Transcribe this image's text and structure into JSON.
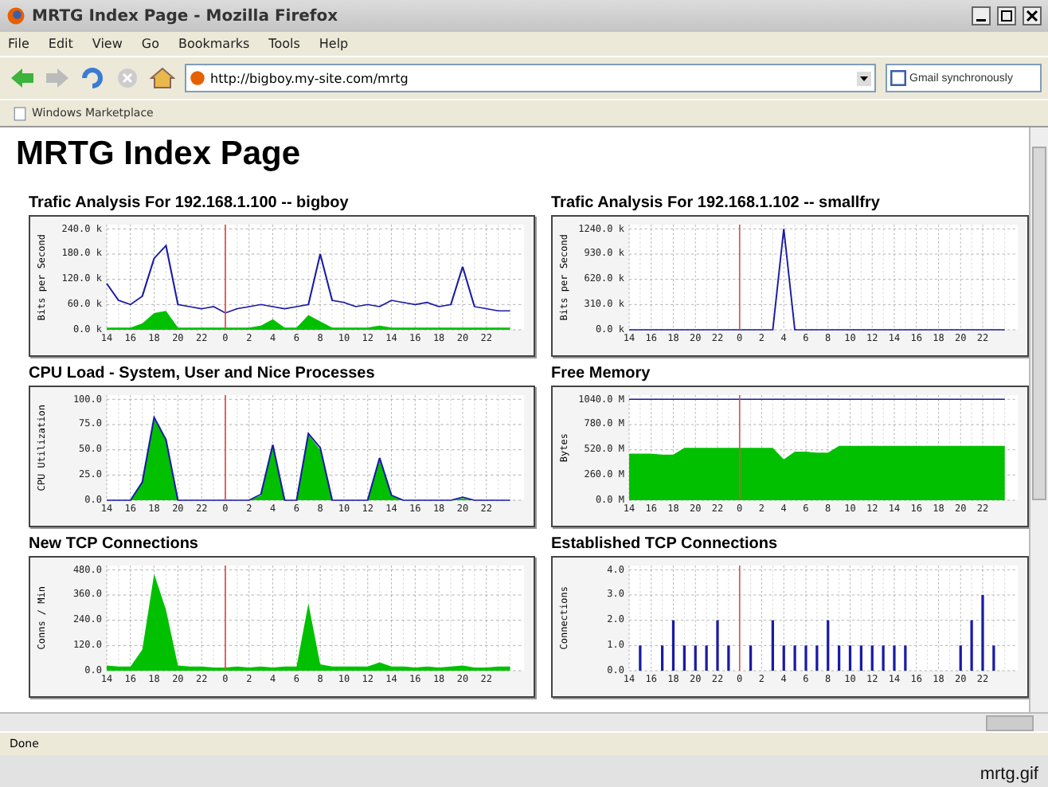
{
  "window": {
    "title": "MRTG Index Page - Mozilla Firefox"
  },
  "menu": [
    "File",
    "Edit",
    "View",
    "Go",
    "Bookmarks",
    "Tools",
    "Help"
  ],
  "address": {
    "value": "http://bigboy.my-site.com/mrtg"
  },
  "search": {
    "placeholder": "Gmail synchronously"
  },
  "bookmarks": [
    "Windows Marketplace"
  ],
  "page": {
    "heading": "MRTG Index Page",
    "graphs": [
      {
        "title": "Trafic Analysis For 192.168.1.100 -- bigboy",
        "chart_data": {
          "type": "area",
          "ylabel": "Bits per Second",
          "grid": true,
          "categories": [
            "14",
            null,
            "16",
            null,
            "18",
            null,
            "20",
            null,
            "22",
            null,
            "0",
            null,
            "2",
            null,
            "4",
            null,
            "6",
            null,
            "8",
            null,
            "10",
            null,
            "12",
            null,
            "14",
            null,
            "16",
            null,
            "18",
            null,
            "20",
            null,
            "22",
            null,
            null
          ],
          "ylim": [
            0,
            240
          ],
          "yticks": [
            {
              "value": 240,
              "label": "240.0 k"
            },
            {
              "value": 180,
              "label": "180.0 k"
            },
            {
              "value": 120,
              "label": "120.0 k"
            },
            {
              "value": 60,
              "label": "60.0 k"
            },
            {
              "value": 0,
              "label": "0.0 k"
            }
          ],
          "series": [
            {
              "color": "#00c000",
              "values": [
                5,
                5,
                5,
                15,
                40,
                45,
                5,
                5,
                5,
                5,
                5,
                5,
                5,
                10,
                25,
                5,
                5,
                35,
                20,
                5,
                5,
                5,
                5,
                10,
                5,
                5,
                5,
                5,
                5,
                5,
                5,
                5,
                5,
                5,
                5
              ]
            },
            {
              "type": "line",
              "color": "#1a1aa6",
              "values": [
                110,
                70,
                60,
                80,
                170,
                200,
                60,
                55,
                50,
                55,
                40,
                50,
                55,
                60,
                55,
                50,
                55,
                60,
                180,
                70,
                65,
                55,
                60,
                55,
                70,
                65,
                60,
                65,
                55,
                60,
                150,
                55,
                50,
                45,
                45
              ]
            }
          ]
        }
      },
      {
        "title": "Trafic Analysis For 192.168.1.102 -- smallfry",
        "chart_data": {
          "type": "line",
          "ylabel": "Bits per Second",
          "grid": true,
          "categories": [
            "14",
            null,
            "16",
            null,
            "18",
            null,
            "20",
            null,
            "22",
            null,
            "0",
            null,
            "2",
            null,
            "4",
            null,
            "6",
            null,
            "8",
            null,
            "10",
            null,
            "12",
            null,
            "14",
            null,
            "16",
            null,
            "18",
            null,
            "20",
            null,
            "22",
            null,
            null
          ],
          "ylim": [
            0,
            1240
          ],
          "yticks": [
            {
              "value": 1240,
              "label": "1240.0 k"
            },
            {
              "value": 930,
              "label": "930.0 k"
            },
            {
              "value": 620,
              "label": "620.0 k"
            },
            {
              "value": 310,
              "label": "310.0 k"
            },
            {
              "value": 0,
              "label": "0.0 k"
            }
          ],
          "series": [
            {
              "color": "#1a1aa6",
              "values": [
                0,
                0,
                0,
                0,
                0,
                0,
                0,
                0,
                0,
                0,
                0,
                0,
                0,
                0,
                1240,
                0,
                0,
                0,
                0,
                0,
                0,
                0,
                0,
                0,
                0,
                0,
                0,
                0,
                0,
                0,
                0,
                0,
                0,
                0,
                0
              ]
            }
          ]
        }
      },
      {
        "title": "CPU Load - System, User and Nice Processes",
        "chart_data": {
          "type": "area",
          "ylabel": "CPU Utilization",
          "grid": true,
          "categories": [
            "14",
            null,
            "16",
            null,
            "18",
            null,
            "20",
            null,
            "22",
            null,
            "0",
            null,
            "2",
            null,
            "4",
            null,
            "6",
            null,
            "8",
            null,
            "10",
            null,
            "12",
            null,
            "14",
            null,
            "16",
            null,
            "18",
            null,
            "20",
            null,
            "22",
            null,
            null
          ],
          "ylim": [
            0,
            100
          ],
          "yticks": [
            {
              "value": 100,
              "label": "100.0"
            },
            {
              "value": 75,
              "label": "75.0"
            },
            {
              "value": 50,
              "label": "50.0"
            },
            {
              "value": 25,
              "label": "25.0"
            },
            {
              "value": 0,
              "label": "0.0"
            }
          ],
          "series": [
            {
              "color": "#00c000",
              "values": [
                0,
                0,
                0,
                18,
                80,
                60,
                0,
                0,
                0,
                0,
                0,
                0,
                0,
                5,
                55,
                0,
                0,
                65,
                50,
                0,
                0,
                0,
                0,
                40,
                5,
                0,
                0,
                0,
                0,
                0,
                2,
                0,
                0,
                0,
                0
              ]
            },
            {
              "type": "line",
              "color": "#1a1aa6",
              "values": [
                0,
                0,
                0,
                18,
                82,
                60,
                0,
                0,
                0,
                0,
                0,
                0,
                0,
                6,
                55,
                0,
                0,
                66,
                52,
                0,
                0,
                0,
                0,
                42,
                5,
                0,
                0,
                0,
                0,
                0,
                3,
                0,
                0,
                0,
                0
              ]
            }
          ]
        }
      },
      {
        "title": "Free Memory",
        "chart_data": {
          "type": "area",
          "ylabel": "Bytes",
          "grid": true,
          "categories": [
            "14",
            null,
            "16",
            null,
            "18",
            null,
            "20",
            null,
            "22",
            null,
            "0",
            null,
            "2",
            null,
            "4",
            null,
            "6",
            null,
            "8",
            null,
            "10",
            null,
            "12",
            null,
            "14",
            null,
            "16",
            null,
            "18",
            null,
            "20",
            null,
            "22",
            null,
            null
          ],
          "ylim": [
            0,
            1040
          ],
          "yticks": [
            {
              "value": 1040,
              "label": "1040.0 M"
            },
            {
              "value": 780,
              "label": "780.0 M"
            },
            {
              "value": 520,
              "label": "520.0 M"
            },
            {
              "value": 260,
              "label": "260.0 M"
            },
            {
              "value": 0,
              "label": "0.0 M"
            }
          ],
          "series": [
            {
              "color": "#00c000",
              "values": [
                480,
                480,
                480,
                470,
                470,
                540,
                540,
                540,
                540,
                540,
                540,
                540,
                540,
                540,
                420,
                500,
                500,
                490,
                490,
                560,
                560,
                560,
                560,
                560,
                560,
                560,
                560,
                560,
                560,
                560,
                560,
                560,
                560,
                560,
                560
              ]
            },
            {
              "type": "line",
              "color": "#1a1aa6",
              "values": [
                1040,
                1040,
                1040,
                1040,
                1040,
                1040,
                1040,
                1040,
                1040,
                1040,
                1040,
                1040,
                1040,
                1040,
                1040,
                1040,
                1040,
                1040,
                1040,
                1040,
                1040,
                1040,
                1040,
                1040,
                1040,
                1040,
                1040,
                1040,
                1040,
                1040,
                1040,
                1040,
                1040,
                1040,
                1040
              ]
            }
          ]
        }
      },
      {
        "title": "New TCP Connections",
        "chart_data": {
          "type": "area",
          "ylabel": "Conns / Min",
          "grid": true,
          "categories": [
            "14",
            null,
            "16",
            null,
            "18",
            null,
            "20",
            null,
            "22",
            null,
            "0",
            null,
            "2",
            null,
            "4",
            null,
            "6",
            null,
            "8",
            null,
            "10",
            null,
            "12",
            null,
            "14",
            null,
            "16",
            null,
            "18",
            null,
            "20",
            null,
            "22",
            null,
            null
          ],
          "ylim": [
            0,
            480
          ],
          "yticks": [
            {
              "value": 480,
              "label": "480.0"
            },
            {
              "value": 360,
              "label": "360.0"
            },
            {
              "value": 240,
              "label": "240.0"
            },
            {
              "value": 120,
              "label": "120.0"
            },
            {
              "value": 0,
              "label": "0.0"
            }
          ],
          "series": [
            {
              "color": "#00c000",
              "values": [
                25,
                20,
                20,
                100,
                460,
                290,
                25,
                20,
                20,
                15,
                15,
                20,
                15,
                20,
                15,
                20,
                20,
                320,
                30,
                20,
                20,
                20,
                20,
                40,
                20,
                20,
                15,
                20,
                15,
                20,
                25,
                15,
                15,
                20,
                20
              ]
            }
          ]
        }
      },
      {
        "title": "Established TCP Connections",
        "chart_data": {
          "type": "bar",
          "ylabel": "Connections",
          "grid": true,
          "categories": [
            "14",
            null,
            "16",
            null,
            "18",
            null,
            "20",
            null,
            "22",
            null,
            "0",
            null,
            "2",
            null,
            "4",
            null,
            "6",
            null,
            "8",
            null,
            "10",
            null,
            "12",
            null,
            "14",
            null,
            "16",
            null,
            "18",
            null,
            "20",
            null,
            "22",
            null,
            null
          ],
          "ylim": [
            0,
            4
          ],
          "yticks": [
            {
              "value": 4,
              "label": "4.0"
            },
            {
              "value": 3,
              "label": "3.0"
            },
            {
              "value": 2,
              "label": "2.0"
            },
            {
              "value": 1,
              "label": "1.0"
            },
            {
              "value": 0,
              "label": "0.0"
            }
          ],
          "series": [
            {
              "color": "#1a1aa6",
              "values": [
                0,
                1,
                0,
                1,
                2,
                1,
                1,
                1,
                2,
                1,
                0,
                1,
                0,
                2,
                1,
                1,
                1,
                1,
                2,
                1,
                1,
                1,
                1,
                1,
                1,
                1,
                0,
                0,
                0,
                0,
                1,
                2,
                3,
                1,
                0
              ]
            }
          ]
        }
      }
    ]
  },
  "status_bar": {
    "text": "Done"
  },
  "caption": "mrtg.gif"
}
